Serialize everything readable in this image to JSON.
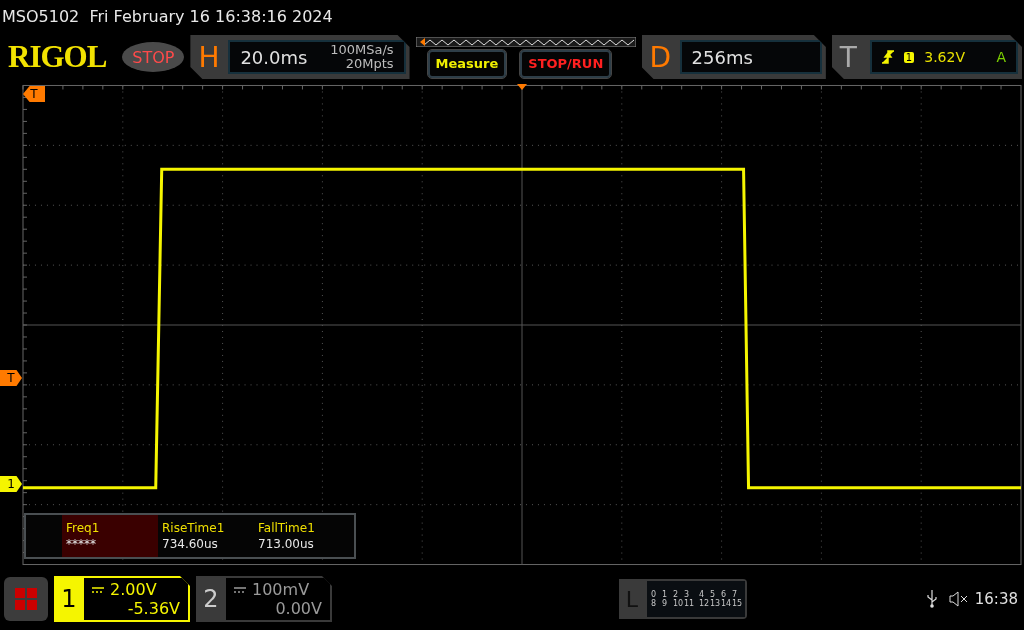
{
  "status_line": "MSO5102  Fri February 16 16:38:16 2024",
  "brand": "RIGOL",
  "run_state": "STOP",
  "horizontal": {
    "label": "H",
    "timebase": "20.0ms",
    "sample_rate": "100MSa/s",
    "memory_depth": "20Mpts"
  },
  "buttons": [
    {
      "label": "Measure",
      "kind": "measure"
    },
    {
      "label": "STOP/RUN",
      "kind": "stoprun"
    }
  ],
  "delay": {
    "label": "D",
    "value": "256ms"
  },
  "trigger": {
    "label": "T",
    "source": "1",
    "level": "3.62V",
    "mode": "A"
  },
  "markers": [
    {
      "label": "T",
      "kind": "horizontal"
    },
    {
      "label": "T",
      "kind": "trigger-level"
    },
    {
      "label": "1",
      "kind": "channel"
    }
  ],
  "measurements": [
    {
      "name": "Freq1",
      "value": "*****",
      "selected": true
    },
    {
      "name": "RiseTime1",
      "value": "734.60us",
      "selected": false
    },
    {
      "name": "FallTime1",
      "value": "713.00us",
      "selected": false
    }
  ],
  "channels": [
    {
      "number": "1",
      "scale": "2.00V",
      "offset": "-5.36V",
      "selected": true
    },
    {
      "number": "2",
      "scale": "100mV",
      "offset": "0.00V",
      "selected": false
    }
  ],
  "logic": {
    "label": "L",
    "rows": [
      [
        "0",
        "1",
        "2",
        "3",
        "4",
        "5",
        "6",
        "7"
      ],
      [
        "8",
        "9",
        "10",
        "11",
        "12",
        "13",
        "14",
        "15"
      ]
    ]
  },
  "clock": "16:38"
}
